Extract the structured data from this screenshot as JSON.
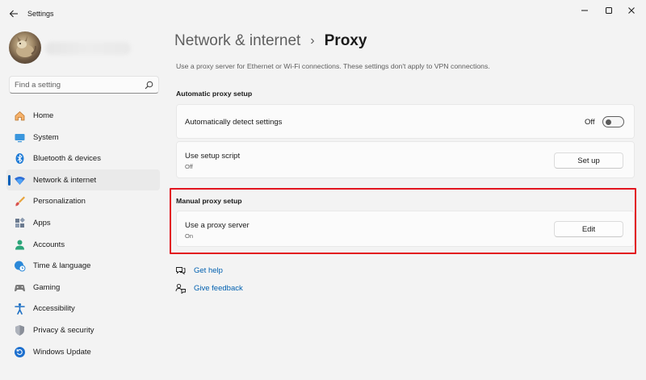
{
  "window": {
    "app_title": "Settings"
  },
  "sidebar": {
    "search": {
      "placeholder": "Find a setting"
    },
    "items": [
      {
        "label": "Home",
        "icon": "home-icon"
      },
      {
        "label": "System",
        "icon": "system-icon"
      },
      {
        "label": "Bluetooth & devices",
        "icon": "bluetooth-icon"
      },
      {
        "label": "Network & internet",
        "icon": "wifi-icon",
        "selected": true
      },
      {
        "label": "Personalization",
        "icon": "brush-icon"
      },
      {
        "label": "Apps",
        "icon": "apps-icon"
      },
      {
        "label": "Accounts",
        "icon": "accounts-icon"
      },
      {
        "label": "Time & language",
        "icon": "globe-clock-icon"
      },
      {
        "label": "Gaming",
        "icon": "gamepad-icon"
      },
      {
        "label": "Accessibility",
        "icon": "accessibility-icon"
      },
      {
        "label": "Privacy & security",
        "icon": "shield-icon"
      },
      {
        "label": "Windows Update",
        "icon": "update-icon"
      }
    ]
  },
  "main": {
    "breadcrumb": {
      "parent": "Network & internet",
      "separator": "›",
      "current": "Proxy"
    },
    "description": "Use a proxy server for Ethernet or Wi-Fi connections. These settings don't apply to VPN connections.",
    "automatic": {
      "title": "Automatic proxy setup",
      "detect": {
        "label": "Automatically detect settings",
        "state": "Off"
      },
      "script": {
        "label": "Use setup script",
        "sub": "Off",
        "button": "Set up"
      }
    },
    "manual": {
      "title": "Manual proxy setup",
      "proxy_server": {
        "label": "Use a proxy server",
        "sub": "On",
        "button": "Edit"
      }
    },
    "links": {
      "help": "Get help",
      "feedback": "Give feedback"
    }
  },
  "colors": {
    "accent": "#005fb8",
    "link": "#0060b0",
    "highlight_border": "#e2141e"
  }
}
